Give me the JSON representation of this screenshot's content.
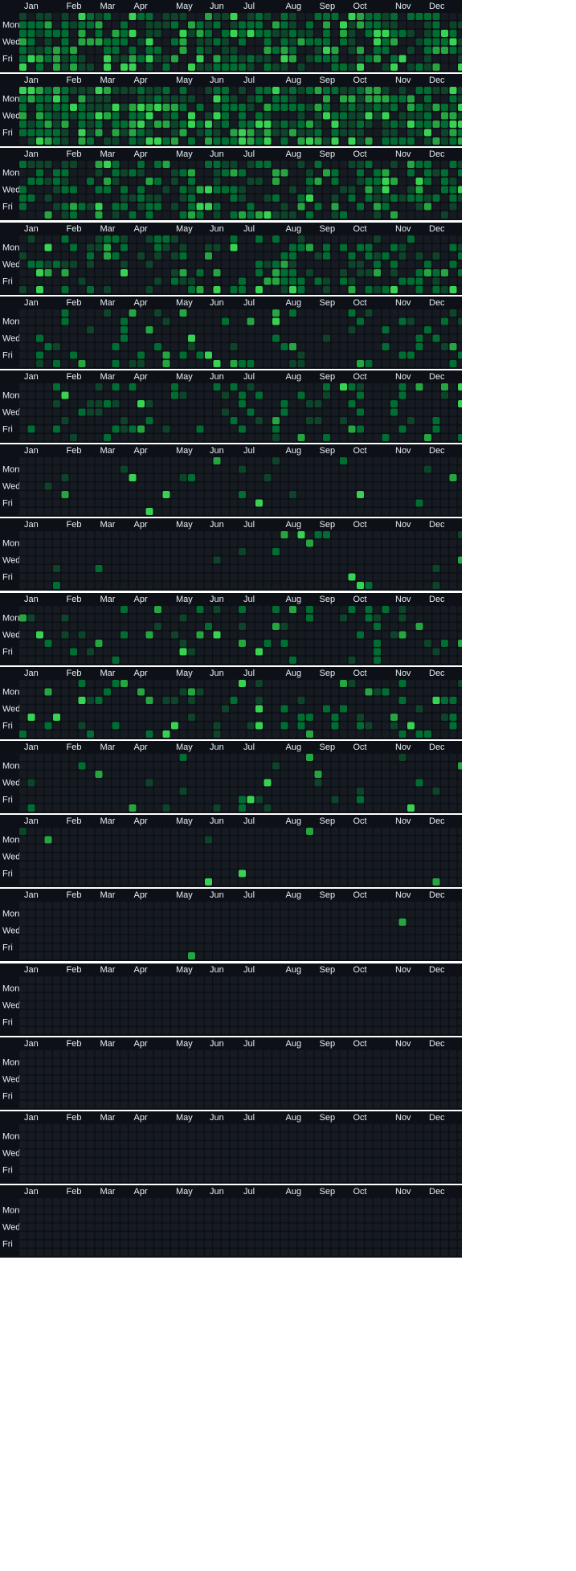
{
  "chart_data": {
    "type": "heatmap",
    "months": [
      "Jan",
      "Feb",
      "Mar",
      "Apr",
      "May",
      "Jun",
      "Jul",
      "Aug",
      "Sep",
      "Oct",
      "Nov",
      "Dec"
    ],
    "weekday_labels": [
      "Mon",
      "Wed",
      "Fri"
    ],
    "levels": 4,
    "colors": {
      "background": "#0d1117",
      "empty": "#161b22",
      "level1": "#0e4429",
      "level2": "#006d32",
      "level3": "#26a641",
      "level4": "#39d353"
    },
    "grids": [
      {
        "name": "row-1",
        "density": 0.72,
        "peak": 0.25
      },
      {
        "name": "row-2",
        "density": 0.8,
        "peak": 0.3
      },
      {
        "name": "row-3",
        "density": 0.55,
        "peak": 0.2
      },
      {
        "name": "row-4",
        "density": 0.4,
        "peak": 0.15
      },
      {
        "name": "row-5",
        "density": 0.15,
        "peak": 0.2
      },
      {
        "name": "row-6",
        "density": 0.22,
        "peak": 0.15
      },
      {
        "name": "row-7",
        "density": 0.06,
        "peak": 0.3
      },
      {
        "name": "row-8",
        "density": 0.07,
        "peak": 0.3
      },
      {
        "name": "row-9",
        "density": 0.15,
        "peak": 0.2
      },
      {
        "name": "row-10",
        "density": 0.16,
        "peak": 0.2
      },
      {
        "name": "row-11",
        "density": 0.09,
        "peak": 0.3
      },
      {
        "name": "row-12",
        "density": 0.015,
        "peak": 0.6
      },
      {
        "name": "row-13",
        "density": 0.004,
        "peak": 1.0
      },
      {
        "name": "row-14",
        "density": 0.0,
        "peak": 0.0
      },
      {
        "name": "row-15",
        "density": 0.0,
        "peak": 0.0
      },
      {
        "name": "row-16",
        "density": 0.0,
        "peak": 0.0
      },
      {
        "name": "row-17",
        "density": 0.002,
        "peak": 1.0
      }
    ]
  }
}
